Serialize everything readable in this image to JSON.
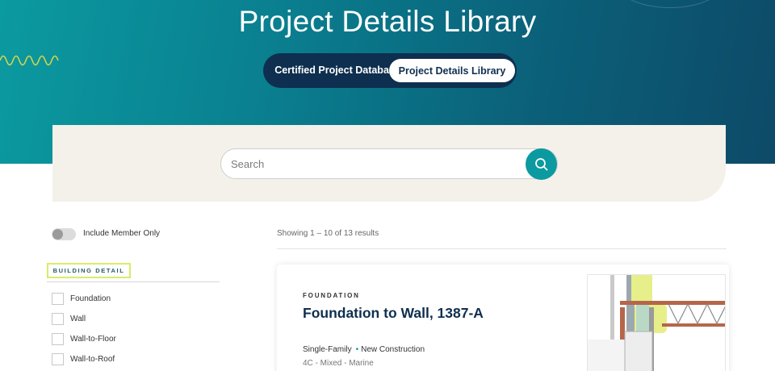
{
  "hero": {
    "title": "Project Details Library",
    "tabs": [
      {
        "label": "Certified Project Database",
        "active": false
      },
      {
        "label": "Project Details Library",
        "active": true
      }
    ]
  },
  "search": {
    "placeholder": "Search",
    "value": "",
    "button_icon": "search-icon"
  },
  "filters": {
    "member_toggle_label": "Include Member Only",
    "member_toggle_on": false,
    "heading": "BUILDING DETAIL",
    "items": [
      {
        "label": "Foundation",
        "checked": false
      },
      {
        "label": "Wall",
        "checked": false
      },
      {
        "label": "Wall-to-Floor",
        "checked": false
      },
      {
        "label": "Wall-to-Roof",
        "checked": false
      }
    ]
  },
  "results": {
    "summary": "Showing 1 – 10 of 13 results",
    "cards": [
      {
        "category": "FOUNDATION",
        "title": "Foundation to Wall, 1387-A",
        "building_type": "Single-Family",
        "construction": "New Construction",
        "meta": "4C - Mixed - Marine"
      }
    ]
  },
  "colors": {
    "teal": "#0b9aa0",
    "navy": "#0e2f4f",
    "panel": "#f3f1ea",
    "highlight": "#d8ec6a"
  }
}
